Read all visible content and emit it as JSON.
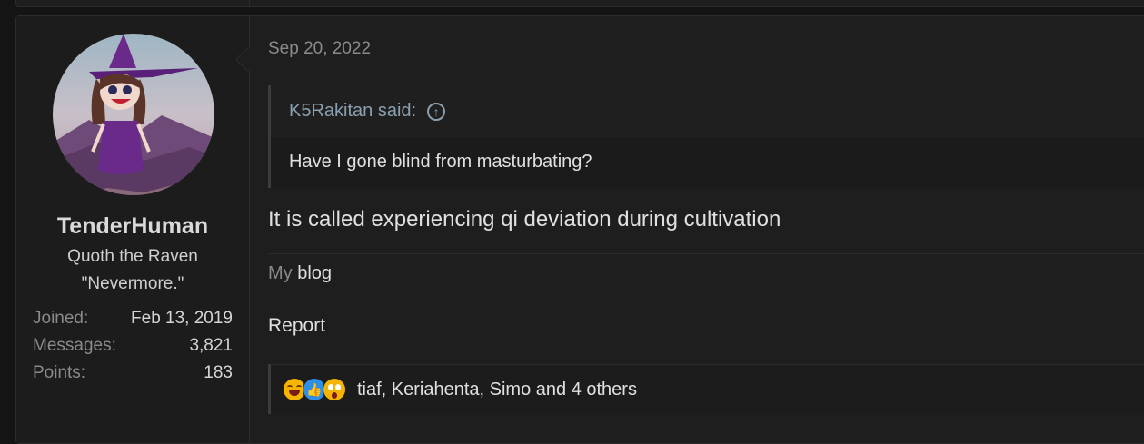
{
  "post": {
    "user": {
      "username": "TenderHuman",
      "title_line1": "Quoth the Raven",
      "title_line2": "\"Nevermore.\"",
      "stats": [
        {
          "label": "Joined:",
          "value": "Feb 13, 2019"
        },
        {
          "label": "Messages:",
          "value": "3,821"
        },
        {
          "label": "Points:",
          "value": "183"
        }
      ]
    },
    "date": "Sep 20, 2022",
    "quote": {
      "author": "K5Rakitan said:",
      "text": "Have I gone blind from masturbating?"
    },
    "message": "It is called experiencing qi deviation during cultivation",
    "signature": {
      "prefix": "My",
      "link": "blog"
    },
    "report_label": "Report",
    "reactions": {
      "icons": [
        "laugh-emoji",
        "like-emoji",
        "wow-emoji"
      ],
      "text": "tiaf, Keriahenta, Simo and 4 others"
    }
  }
}
